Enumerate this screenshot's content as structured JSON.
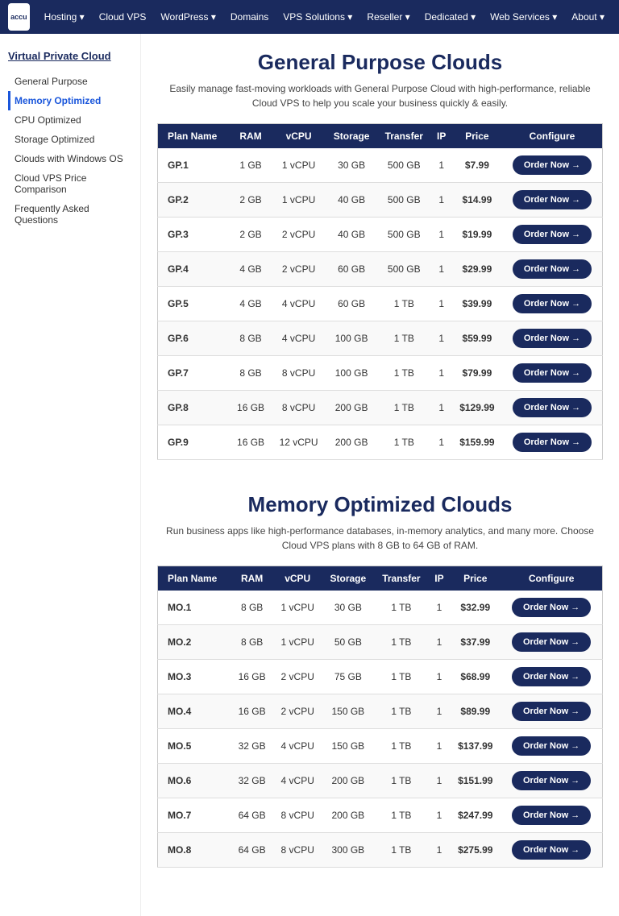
{
  "nav": {
    "logo_text": "accu",
    "items": [
      {
        "label": "Hosting ▾"
      },
      {
        "label": "Cloud VPS"
      },
      {
        "label": "WordPress ▾"
      },
      {
        "label": "Domains"
      },
      {
        "label": "VPS Solutions ▾"
      },
      {
        "label": "Reseller ▾"
      },
      {
        "label": "Dedicated ▾"
      },
      {
        "label": "Web Services ▾"
      },
      {
        "label": "About ▾"
      }
    ]
  },
  "sidebar": {
    "section_title": "Virtual Private Cloud",
    "items": [
      {
        "label": "General Purpose",
        "active": false
      },
      {
        "label": "Memory Optimized",
        "active": true
      },
      {
        "label": "CPU Optimized",
        "active": false
      },
      {
        "label": "Storage Optimized",
        "active": false
      },
      {
        "label": "Clouds with Windows OS",
        "active": false
      },
      {
        "label": "Cloud VPS Price Comparison",
        "active": false
      },
      {
        "label": "Frequently Asked Questions",
        "active": false
      }
    ]
  },
  "general_purpose": {
    "title": "General Purpose Clouds",
    "description": "Easily manage fast-moving workloads with General Purpose Cloud with high-performance, reliable Cloud VPS to help you scale your business quickly & easily.",
    "columns": [
      "Plan Name",
      "RAM",
      "vCPU",
      "Storage",
      "Transfer",
      "IP",
      "Price",
      "Configure"
    ],
    "button_label": "Order Now →",
    "plans": [
      {
        "name": "GP.1",
        "ram": "1 GB",
        "vcpu": "1 vCPU",
        "storage": "30 GB",
        "transfer": "500 GB",
        "ip": "1",
        "price": "$7.99"
      },
      {
        "name": "GP.2",
        "ram": "2 GB",
        "vcpu": "1 vCPU",
        "storage": "40 GB",
        "transfer": "500 GB",
        "ip": "1",
        "price": "$14.99"
      },
      {
        "name": "GP.3",
        "ram": "2 GB",
        "vcpu": "2 vCPU",
        "storage": "40 GB",
        "transfer": "500 GB",
        "ip": "1",
        "price": "$19.99"
      },
      {
        "name": "GP.4",
        "ram": "4 GB",
        "vcpu": "2 vCPU",
        "storage": "60 GB",
        "transfer": "500 GB",
        "ip": "1",
        "price": "$29.99"
      },
      {
        "name": "GP.5",
        "ram": "4 GB",
        "vcpu": "4 vCPU",
        "storage": "60 GB",
        "transfer": "1 TB",
        "ip": "1",
        "price": "$39.99"
      },
      {
        "name": "GP.6",
        "ram": "8 GB",
        "vcpu": "4 vCPU",
        "storage": "100 GB",
        "transfer": "1 TB",
        "ip": "1",
        "price": "$59.99"
      },
      {
        "name": "GP.7",
        "ram": "8 GB",
        "vcpu": "8 vCPU",
        "storage": "100 GB",
        "transfer": "1 TB",
        "ip": "1",
        "price": "$79.99"
      },
      {
        "name": "GP.8",
        "ram": "16 GB",
        "vcpu": "8 vCPU",
        "storage": "200 GB",
        "transfer": "1 TB",
        "ip": "1",
        "price": "$129.99"
      },
      {
        "name": "GP.9",
        "ram": "16 GB",
        "vcpu": "12 vCPU",
        "storage": "200 GB",
        "transfer": "1 TB",
        "ip": "1",
        "price": "$159.99"
      }
    ]
  },
  "memory_optimized": {
    "title": "Memory Optimized Clouds",
    "description": "Run business apps like high-performance databases, in-memory analytics, and many more. Choose Cloud VPS plans with 8 GB to 64 GB of RAM.",
    "columns": [
      "Plan Name",
      "RAM",
      "vCPU",
      "Storage",
      "Transfer",
      "IP",
      "Price",
      "Configure"
    ],
    "button_label": "Order Now →",
    "plans": [
      {
        "name": "MO.1",
        "ram": "8 GB",
        "vcpu": "1 vCPU",
        "storage": "30 GB",
        "transfer": "1 TB",
        "ip": "1",
        "price": "$32.99"
      },
      {
        "name": "MO.2",
        "ram": "8 GB",
        "vcpu": "1 vCPU",
        "storage": "50 GB",
        "transfer": "1 TB",
        "ip": "1",
        "price": "$37.99"
      },
      {
        "name": "MO.3",
        "ram": "16 GB",
        "vcpu": "2 vCPU",
        "storage": "75 GB",
        "transfer": "1 TB",
        "ip": "1",
        "price": "$68.99"
      },
      {
        "name": "MO.4",
        "ram": "16 GB",
        "vcpu": "2 vCPU",
        "storage": "150 GB",
        "transfer": "1 TB",
        "ip": "1",
        "price": "$89.99"
      },
      {
        "name": "MO.5",
        "ram": "32 GB",
        "vcpu": "4 vCPU",
        "storage": "150 GB",
        "transfer": "1 TB",
        "ip": "1",
        "price": "$137.99"
      },
      {
        "name": "MO.6",
        "ram": "32 GB",
        "vcpu": "4 vCPU",
        "storage": "200 GB",
        "transfer": "1 TB",
        "ip": "1",
        "price": "$151.99"
      },
      {
        "name": "MO.7",
        "ram": "64 GB",
        "vcpu": "8 vCPU",
        "storage": "200 GB",
        "transfer": "1 TB",
        "ip": "1",
        "price": "$247.99"
      },
      {
        "name": "MO.8",
        "ram": "64 GB",
        "vcpu": "8 vCPU",
        "storage": "300 GB",
        "transfer": "1 TB",
        "ip": "1",
        "price": "$275.99"
      }
    ]
  }
}
